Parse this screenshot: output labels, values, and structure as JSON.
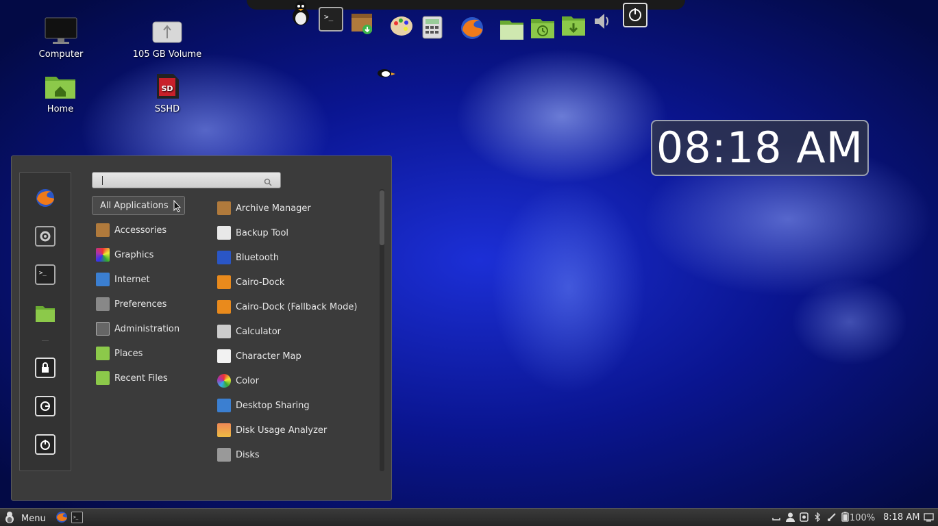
{
  "desktop": {
    "icons": [
      {
        "label": "Computer"
      },
      {
        "label": "105 GB Volume"
      },
      {
        "label": "Home"
      },
      {
        "label": "SSHD"
      }
    ],
    "clock": "08:18 AM"
  },
  "dock": {
    "items": [
      "penguin-icon",
      "terminal-icon",
      "package-installer-icon",
      "paint-icon",
      "calculator-icon",
      "firefox-icon",
      "files-icon",
      "backup-icon",
      "downloads-folder-icon",
      "volume-icon",
      "power-icon"
    ]
  },
  "menu": {
    "search": {
      "placeholder": ""
    },
    "categories": [
      {
        "label": "All Applications",
        "active": true
      },
      {
        "label": "Accessories"
      },
      {
        "label": "Graphics"
      },
      {
        "label": "Internet"
      },
      {
        "label": "Preferences"
      },
      {
        "label": "Administration"
      },
      {
        "label": "Places"
      },
      {
        "label": "Recent Files"
      }
    ],
    "apps": [
      {
        "label": "Archive Manager"
      },
      {
        "label": "Backup Tool"
      },
      {
        "label": "Bluetooth"
      },
      {
        "label": "Cairo-Dock"
      },
      {
        "label": "Cairo-Dock (Fallback Mode)"
      },
      {
        "label": "Calculator"
      },
      {
        "label": "Character Map"
      },
      {
        "label": "Color"
      },
      {
        "label": "Desktop Sharing"
      },
      {
        "label": "Disk Usage Analyzer"
      },
      {
        "label": "Disks"
      }
    ],
    "favorites": [
      "firefox-icon",
      "settings-icon",
      "terminal-icon",
      "folder-icon",
      "lock-icon",
      "logout-icon",
      "shutdown-icon"
    ]
  },
  "taskbar": {
    "menu_label": "Menu",
    "battery": "100%",
    "time": "8:18 AM"
  },
  "colors": {
    "menu_bg": "#3b3b3b",
    "taskbar_bg": "#2a2a2a",
    "desktop_blue": "#0a1590"
  }
}
